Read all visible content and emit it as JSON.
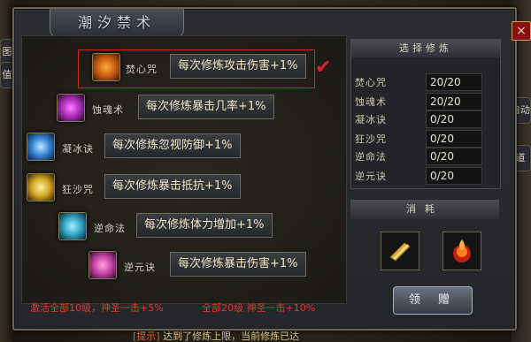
{
  "window": {
    "title": "潮汐禁术",
    "close": "×"
  },
  "skills": [
    {
      "name": "焚心咒",
      "desc": "每次修炼攻击伤害+1%",
      "icon": "fire-heart-icon",
      "color": "#c85a10"
    },
    {
      "name": "蚀魂术",
      "desc": "每次修炼暴击几率+1%",
      "icon": "soul-eater-icon",
      "color": "#b030c0"
    },
    {
      "name": "凝冰诀",
      "desc": "每次修炼忽视防御+1%",
      "icon": "ice-icon",
      "color": "#3080d0"
    },
    {
      "name": "狂沙咒",
      "desc": "每次修炼暴击抵抗+1%",
      "icon": "sand-icon",
      "color": "#d0a020"
    },
    {
      "name": "逆命法",
      "desc": "每次修炼体力增加+1%",
      "icon": "fate-icon",
      "color": "#30a0c0"
    },
    {
      "name": "逆元诀",
      "desc": "每次修炼暴击伤害+1%",
      "icon": "yuan-icon",
      "color": "#c040a0"
    }
  ],
  "selected_check": "✔",
  "footer": {
    "activate_10": "激活全部10级，神圣一击+5%",
    "activate_20": "全部20级 神圣一击+10%"
  },
  "practice": {
    "header": "选择修炼",
    "rows": [
      {
        "label": "焚心咒",
        "value": "20/20"
      },
      {
        "label": "蚀魂术",
        "value": "20/20"
      },
      {
        "label": "凝冰诀",
        "value": "0/20"
      },
      {
        "label": "狂沙咒",
        "value": "0/20"
      },
      {
        "label": "逆命法",
        "value": "0/20"
      },
      {
        "label": "逆元诀",
        "value": "0/20"
      }
    ]
  },
  "cost": {
    "header": "消耗",
    "items": [
      "scroll-item-icon",
      "flame-item-icon"
    ]
  },
  "claim_button": "领 赠",
  "side_tabs": [
    "图",
    "值",
    "自动",
    "道"
  ],
  "bottom_chat": {
    "prefix": "[提示]",
    "text": "达到了修炼上限，当前修炼已达"
  }
}
